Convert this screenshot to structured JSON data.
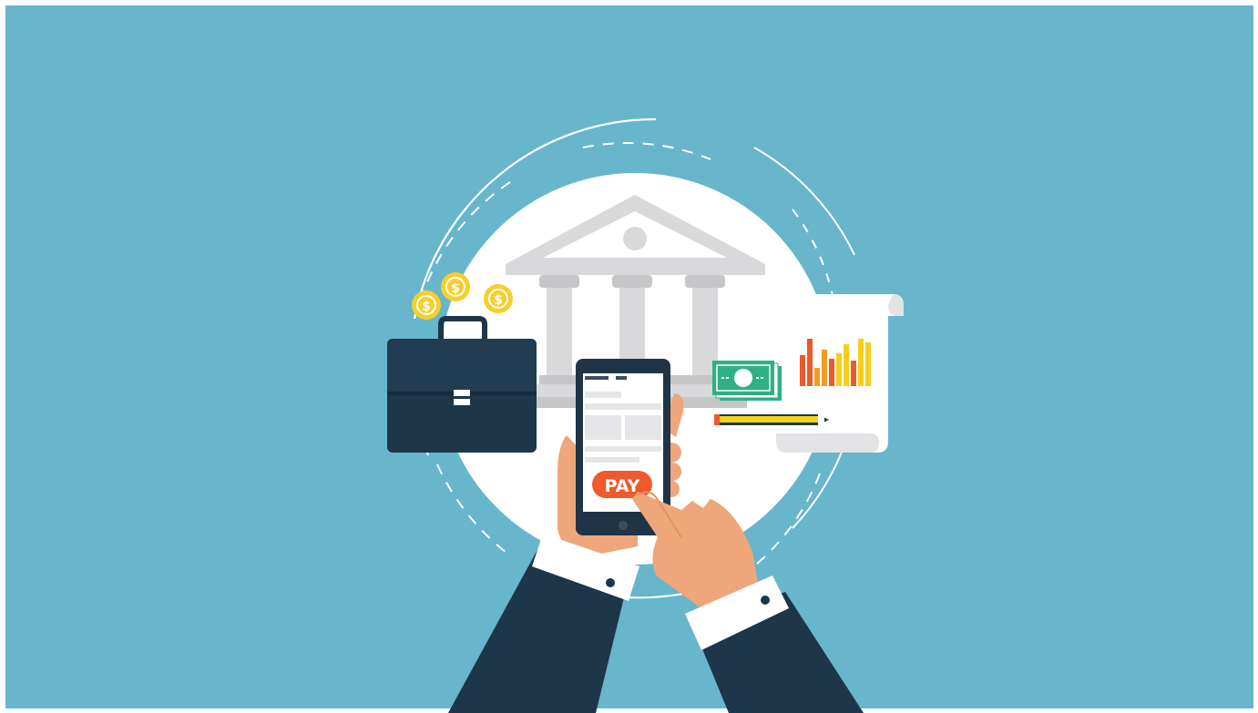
{
  "illustration": {
    "pay_button_label": "PAY",
    "coin_symbol": "$",
    "colors": {
      "background": "#67b6cb",
      "circle": "#ffffff",
      "building": "#d9d9db",
      "briefcase": "#1d3649",
      "phone": "#1f3447",
      "pay_button": "#ee5a2b",
      "skin": "#eea67a",
      "suit": "#1d3649",
      "coin": "#f7cf2a",
      "cash": "#2fb085",
      "chart_red": "#ea5a2b",
      "chart_orange": "#f39c21",
      "chart_yellow": "#f6cf1d",
      "pencil": "#f6d21d"
    },
    "icons": [
      "bank-building-icon",
      "briefcase-icon",
      "coin-icon",
      "smartphone-icon",
      "cash-icon",
      "report-scroll-icon",
      "pencil-icon",
      "hand-icon"
    ]
  }
}
